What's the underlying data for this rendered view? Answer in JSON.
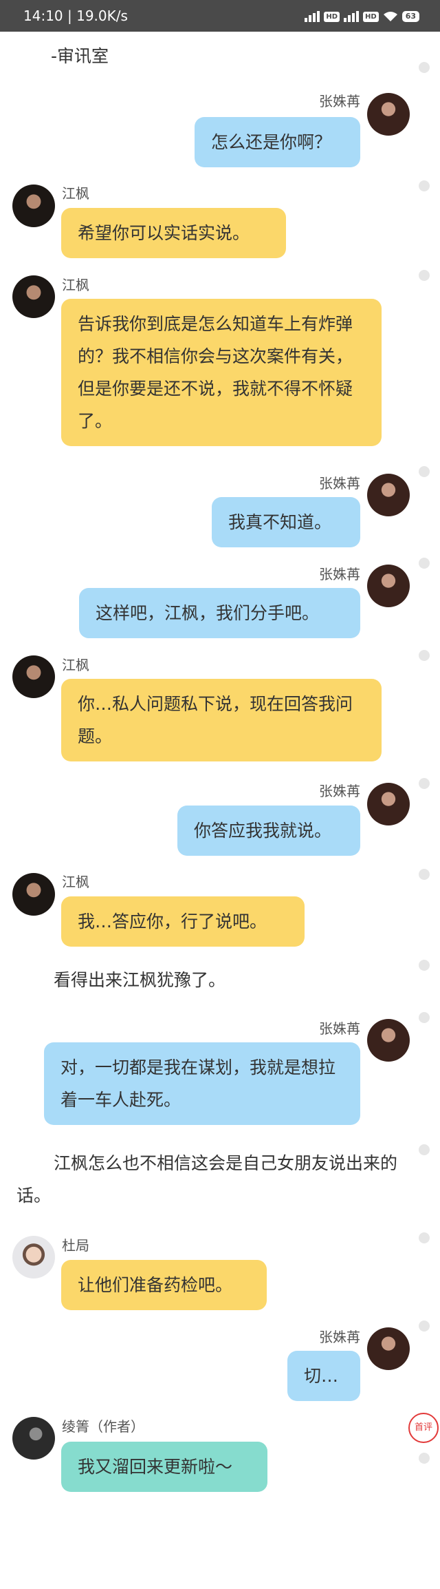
{
  "status_bar": {
    "time_speed": "14:10 | 19.0K/s",
    "hd_badge": "HD",
    "battery": "63"
  },
  "story": {
    "scene_title": "-审讯室",
    "messages": [
      {
        "kind": "bubble",
        "side": "right",
        "speaker": "张姝苒",
        "text": "怎么还是你啊？",
        "color": "blue"
      },
      {
        "kind": "bubble",
        "side": "left",
        "speaker": "江枫",
        "text": "希望你可以实话实说。",
        "color": "yellow"
      },
      {
        "kind": "bubble",
        "side": "left",
        "speaker": "江枫",
        "text": "告诉我你到底是怎么知道车上有炸弹的？我不相信你会与这次案件有关，但是你要是还不说，我就不得不怀疑了。",
        "color": "yellow"
      },
      {
        "kind": "bubble",
        "side": "right",
        "speaker": "张姝苒",
        "text": "我真不知道。",
        "color": "blue"
      },
      {
        "kind": "bubble",
        "side": "right",
        "speaker": "张姝苒",
        "text": "这样吧，江枫，我们分手吧。",
        "color": "blue"
      },
      {
        "kind": "bubble",
        "side": "left",
        "speaker": "江枫",
        "text": "你…私人问题私下说，现在回答我问题。",
        "color": "yellow"
      },
      {
        "kind": "bubble",
        "side": "right",
        "speaker": "张姝苒",
        "text": "你答应我我就说。",
        "color": "blue"
      },
      {
        "kind": "bubble",
        "side": "left",
        "speaker": "江枫",
        "text": "我…答应你，行了说吧。",
        "color": "yellow"
      },
      {
        "kind": "narration",
        "text": "看得出来江枫犹豫了。"
      },
      {
        "kind": "bubble",
        "side": "right",
        "speaker": "张姝苒",
        "text": "对，一切都是我在谋划，我就是想拉着一车人赴死。",
        "color": "blue"
      },
      {
        "kind": "narration",
        "text": "江枫怎么也不相信这会是自己女朋友说出来的话。"
      },
      {
        "kind": "bubble",
        "side": "left",
        "speaker": "杜局",
        "text": "让他们准备药检吧。",
        "color": "yellow"
      },
      {
        "kind": "bubble",
        "side": "right",
        "speaker": "张姝苒",
        "text": "切…",
        "color": "blue"
      },
      {
        "kind": "bubble",
        "side": "left",
        "speaker": "绫箐（作者）",
        "text": "我又溜回来更新啦～",
        "color": "teal"
      }
    ]
  },
  "comment_badge": "首评",
  "colors": {
    "status_bar": "#4a4a4a",
    "bubble_blue": "#a9dbf8",
    "bubble_yellow": "#fbd76a",
    "bubble_teal": "#86dcce",
    "comment_red": "#e23a3a"
  }
}
